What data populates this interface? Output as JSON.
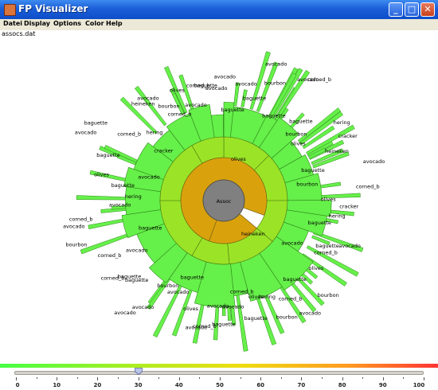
{
  "window": {
    "title": "FP Visualizer"
  },
  "menu": [
    "Datei",
    "Display",
    "Options",
    "Color",
    "Help"
  ],
  "file_label": "assocs.dat",
  "center_label": "Assoc",
  "ring1_labels": [
    "olives",
    "heineken"
  ],
  "outer_labels": [
    "avocado",
    "baguette",
    "avocado",
    "baguette",
    "avocado",
    "bourbon",
    "baguette",
    "avocado",
    "corned_b",
    "baguette",
    "bourbon",
    "olives",
    "hering",
    "cracker",
    "heineken",
    "baguette",
    "avocado",
    "bourbon",
    "corned_b",
    "olives",
    "cracker",
    "hering",
    "baguette",
    "avocado",
    "baguette",
    "corned_b",
    "avocado",
    "olives",
    "bourbon",
    "baguette",
    "avocado",
    "corned_b",
    "bourbon",
    "hering",
    "olives",
    "baguette",
    "corned_b",
    "avocado",
    "baguette",
    "avocado",
    "corned_b",
    "avocado",
    "olives",
    "baguette",
    "avocado",
    "bourbon",
    "avocado",
    "avocado",
    "baguette",
    "baguette",
    "corned_b",
    "avocado",
    "corned_b",
    "baguette",
    "bourbon",
    "avocado",
    "corned_b",
    "avocado",
    "hering",
    "baguette",
    "olives",
    "avocado",
    "baguette",
    "avocado",
    "baguette",
    "corned_b",
    "cracker",
    "hering",
    "heineken",
    "avocado",
    "bourbon",
    "corned_b",
    "olives",
    "avocado",
    "corned_b",
    "baguette",
    "avocado"
  ],
  "slider": {
    "value": 30,
    "min": 0,
    "max": 100,
    "tick_labels": [
      "0",
      "10",
      "20",
      "30",
      "40",
      "50",
      "60",
      "70",
      "80",
      "90",
      "100"
    ]
  },
  "colors": {
    "center": "#808080",
    "ring1": "#d9a20d",
    "ring2": "#9be327",
    "outer": "#66f04a",
    "outer_edge": "#2f8a1a"
  }
}
